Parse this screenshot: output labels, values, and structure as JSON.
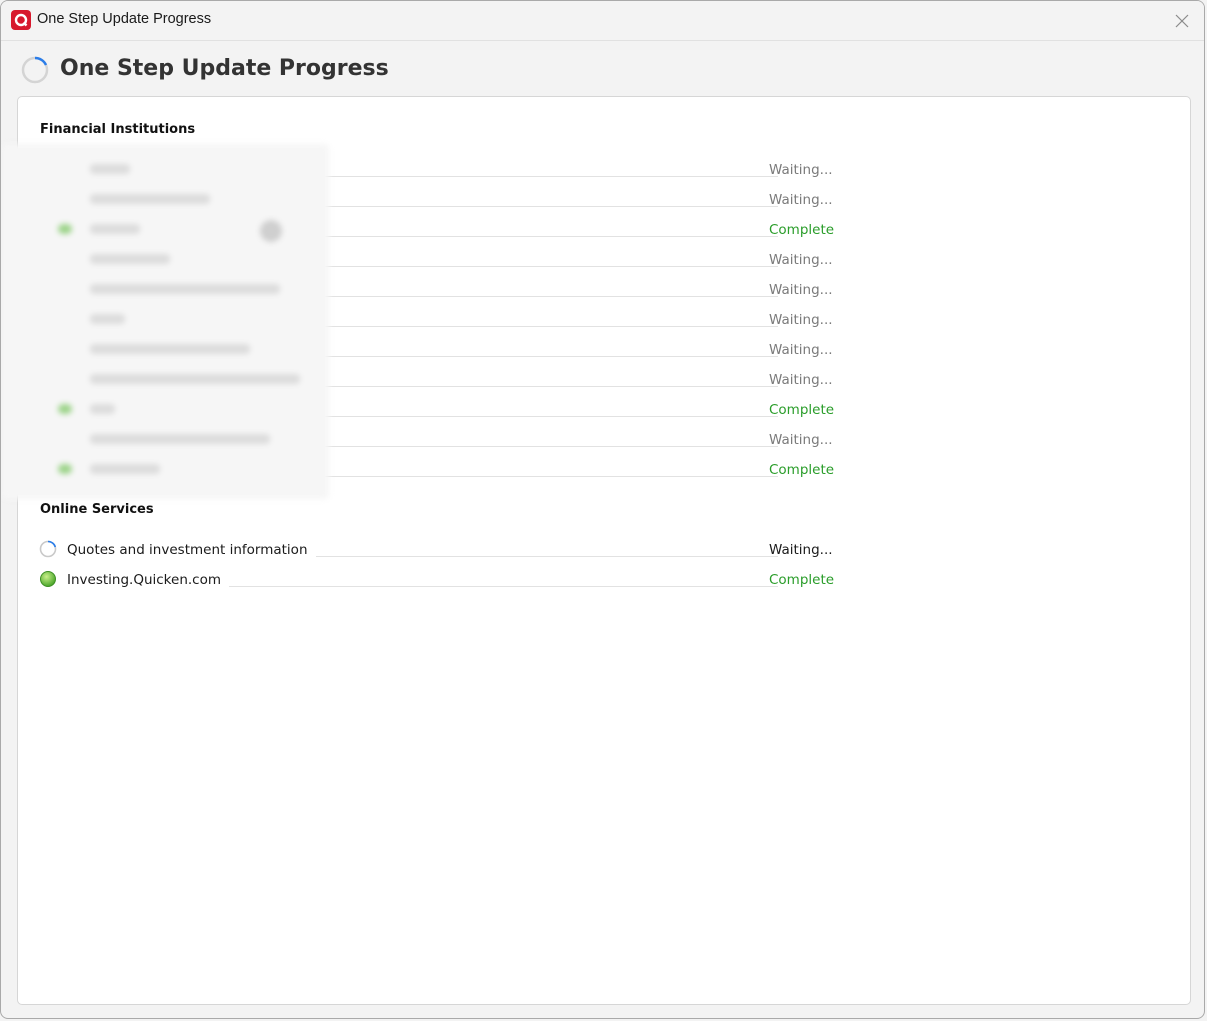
{
  "window": {
    "title": "One Step Update Progress",
    "app_icon": "quicken-logo-icon",
    "close_icon": "close-icon"
  },
  "header": {
    "title": "One Step Update Progress",
    "icon": "loading-spinner-icon"
  },
  "financial_institutions": {
    "section_title": "Financial Institutions",
    "rows": [
      {
        "status": "Waiting...",
        "state": "waiting"
      },
      {
        "status": "Waiting...",
        "state": "waiting"
      },
      {
        "status": "Complete",
        "state": "complete"
      },
      {
        "status": "Waiting...",
        "state": "waiting"
      },
      {
        "status": "Waiting...",
        "state": "waiting"
      },
      {
        "status": "Waiting...",
        "state": "waiting"
      },
      {
        "status": "Waiting...",
        "state": "waiting"
      },
      {
        "status": "Waiting...",
        "state": "waiting"
      },
      {
        "status": "Complete",
        "state": "complete"
      },
      {
        "status": "Waiting...",
        "state": "waiting"
      },
      {
        "status": "Complete",
        "state": "complete"
      }
    ]
  },
  "online_services": {
    "section_title": "Online Services",
    "rows": [
      {
        "label": "Quotes and investment information",
        "status": "Waiting...",
        "state": "waiting",
        "icon": "loading-spinner-icon"
      },
      {
        "label": "Investing.Quicken.com",
        "status": "Complete",
        "state": "complete",
        "icon": "complete-green-dot-icon"
      }
    ]
  },
  "colors": {
    "accent_red": "#d7192d",
    "complete_green": "#2a9d2a",
    "waiting_gray": "#7a7a7a"
  }
}
